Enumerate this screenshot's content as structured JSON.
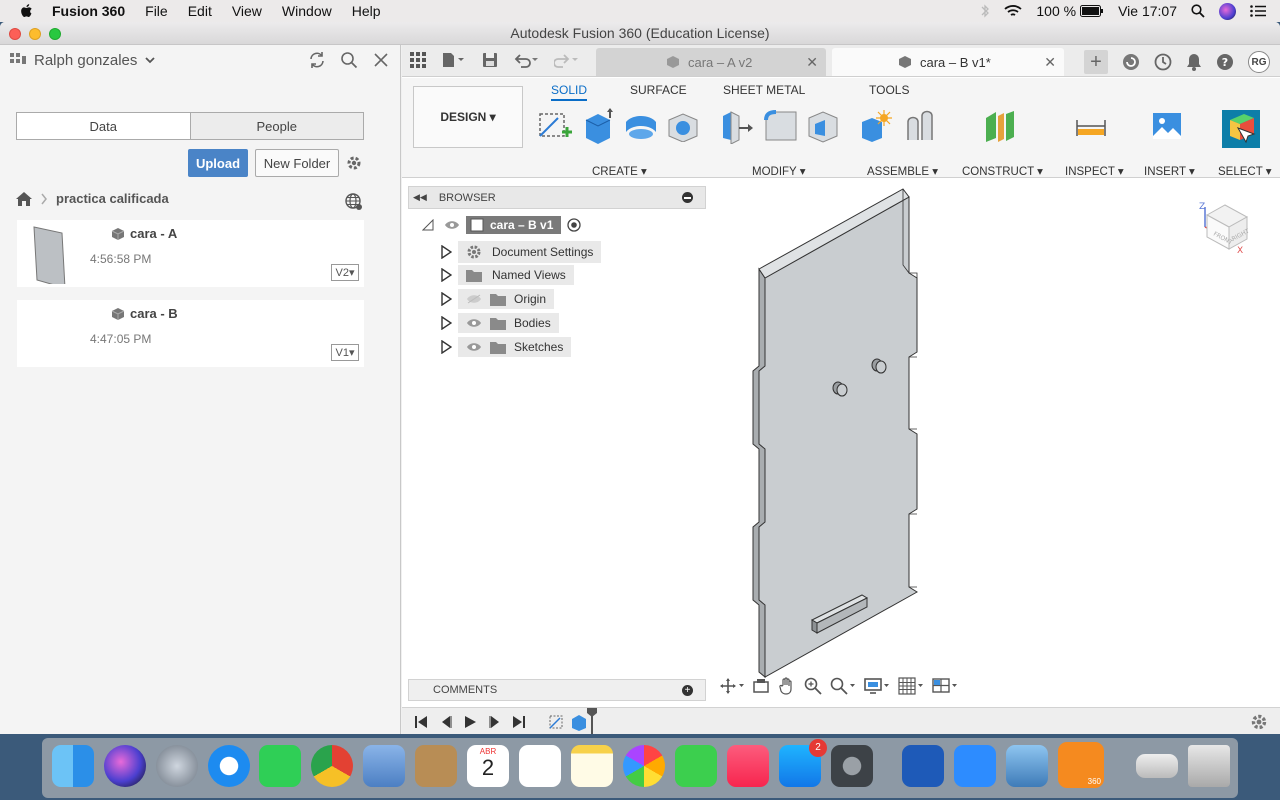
{
  "menubar": {
    "app_name": "Fusion 360",
    "items": [
      "File",
      "Edit",
      "View",
      "Window",
      "Help"
    ],
    "battery": "100 %",
    "clock": "Vie 17:07"
  },
  "window": {
    "title": "Autodesk Fusion 360 (Education License)"
  },
  "data_panel": {
    "user": "Ralph gonzales",
    "tabs": [
      "Data",
      "People"
    ],
    "upload_label": "Upload",
    "new_folder_label": "New Folder",
    "breadcrumb": "practica calificada",
    "files": [
      {
        "name": "cara - A",
        "time": "4:56:58 PM",
        "version": "V2"
      },
      {
        "name": "cara - B",
        "time": "4:47:05 PM",
        "version": "V1"
      }
    ]
  },
  "doc_tabs": [
    {
      "label": "cara – A v2"
    },
    {
      "label": "cara – B v1*"
    }
  ],
  "user_initials": "RG",
  "ribbon": {
    "workspace": "DESIGN",
    "tabs": [
      "SOLID",
      "SURFACE",
      "SHEET METAL",
      "TOOLS"
    ],
    "active_tab": "SOLID",
    "groups": [
      "CREATE",
      "MODIFY",
      "ASSEMBLE",
      "CONSTRUCT",
      "INSPECT",
      "INSERT",
      "SELECT"
    ]
  },
  "browser": {
    "title": "BROWSER",
    "root": "cara – B v1",
    "nodes": [
      "Document Settings",
      "Named Views",
      "Origin",
      "Bodies",
      "Sketches"
    ]
  },
  "comments_label": "COMMENTS",
  "colors": {
    "accent": "#0a6dc7",
    "upload_button": "#4a84c7",
    "model_fill": "#c9cdd0"
  },
  "dock": {
    "calendar_month": "ABR",
    "calendar_day": "2",
    "appstore_badge": "2",
    "fusion_badge": "360"
  }
}
